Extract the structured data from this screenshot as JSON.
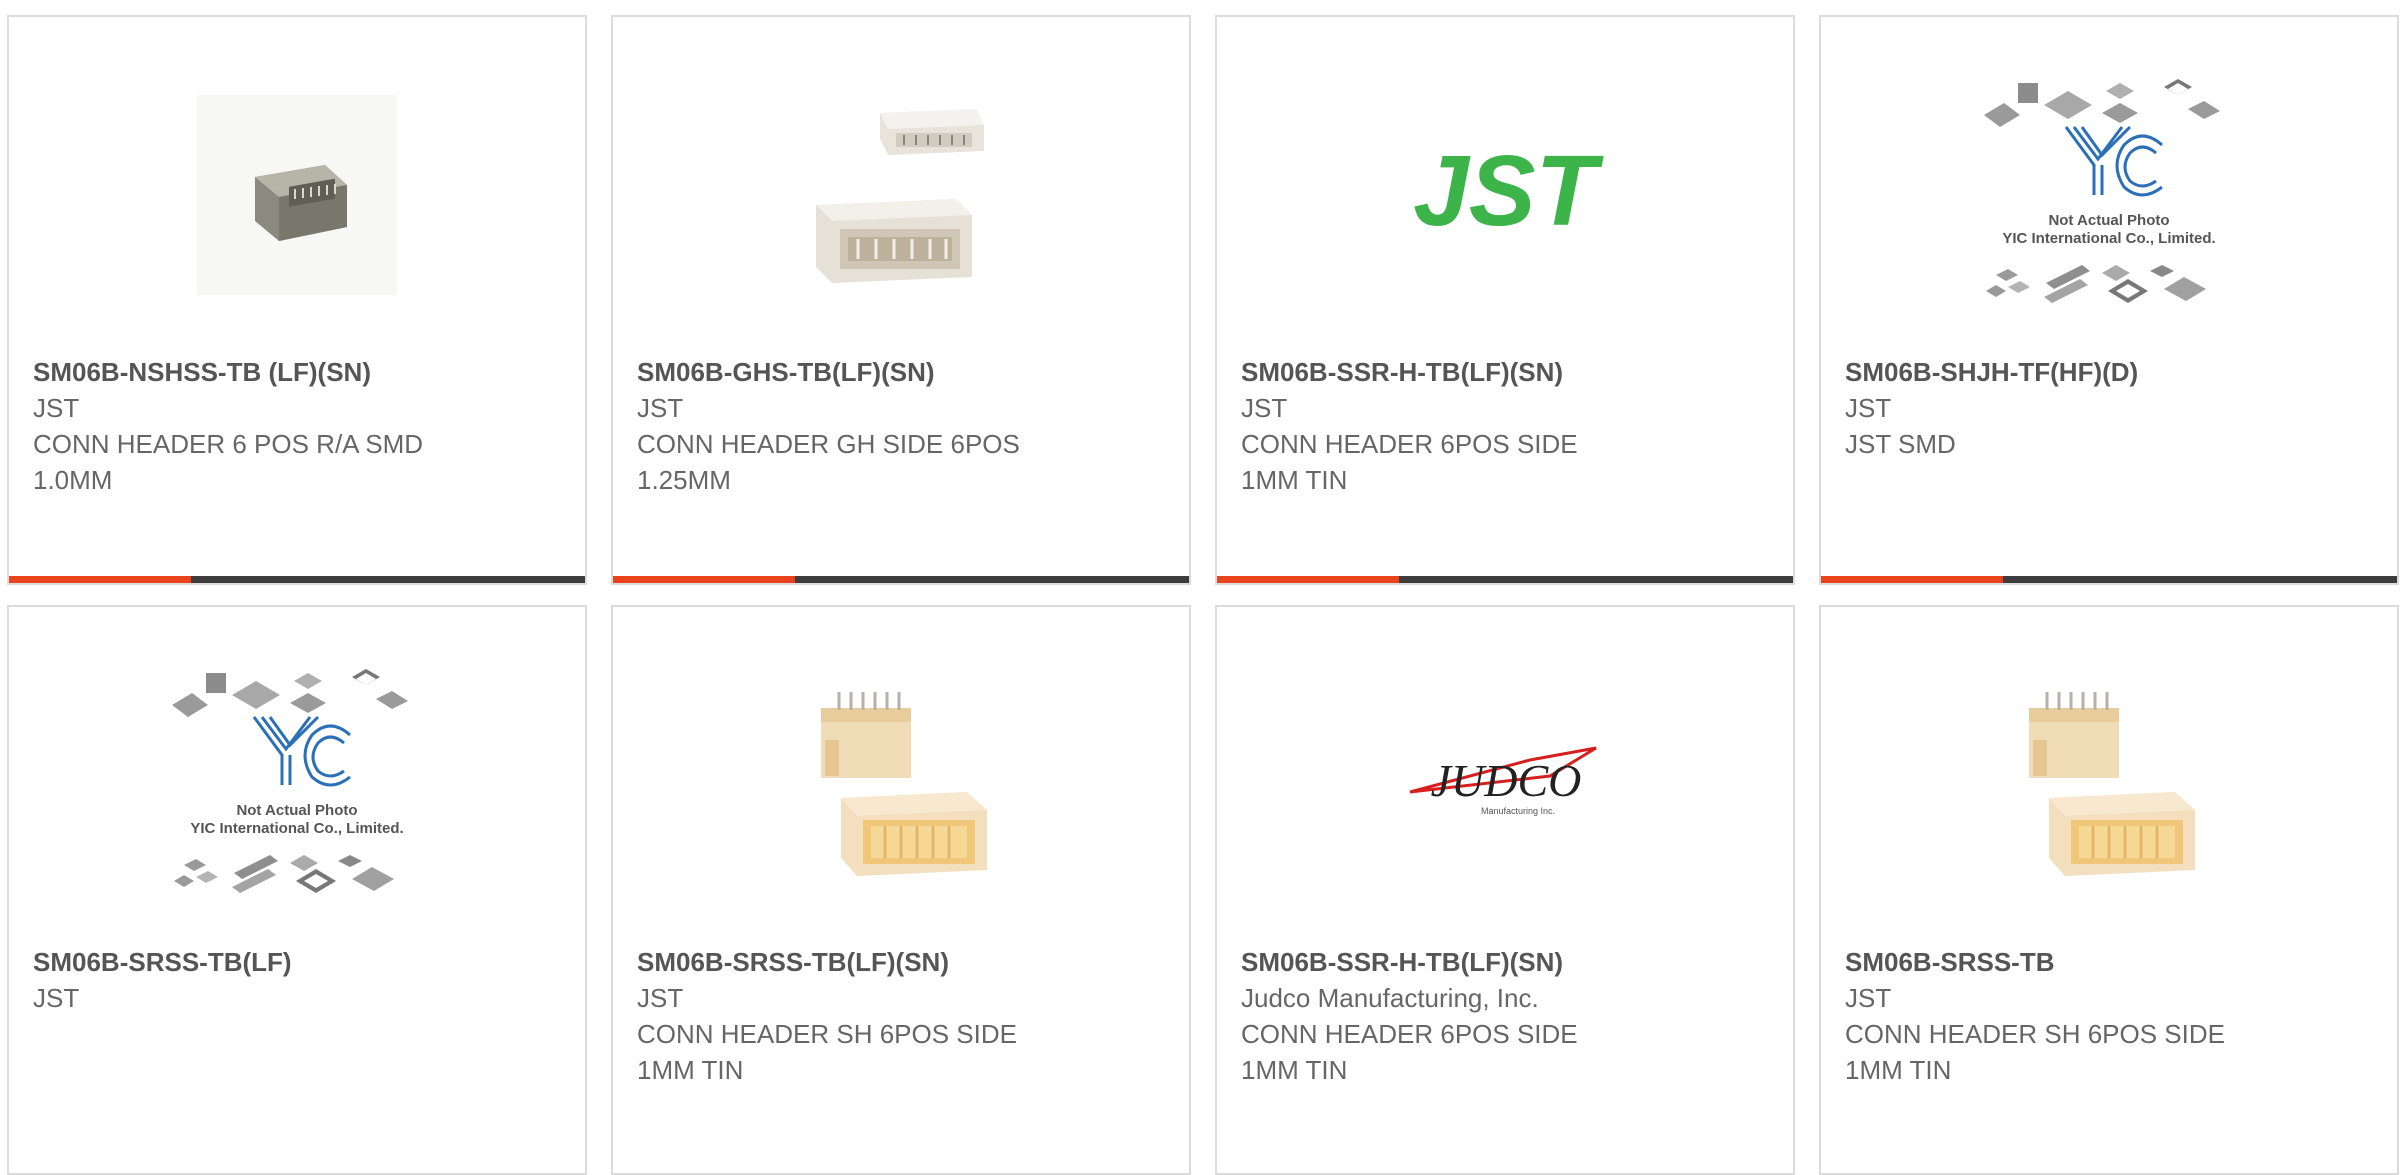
{
  "colors": {
    "accent": "#e8431c",
    "bar": "#3d3d3d",
    "jst_green": "#3cb44a",
    "yic_blue": "#2a6fb7"
  },
  "products": [
    {
      "part": "SM06B-NSHSS-TB (LF)(SN)",
      "maker": "JST",
      "desc1": "CONN HEADER 6 POS R/A SMD",
      "desc2": "1.0MM",
      "image": "gray-connector-photo"
    },
    {
      "part": "SM06B-GHS-TB(LF)(SN)",
      "maker": "JST",
      "desc1": "CONN HEADER GH SIDE 6POS",
      "desc2": "1.25MM",
      "image": "white-connector-photo"
    },
    {
      "part": "SM06B-SSR-H-TB(LF)(SN)",
      "maker": "JST",
      "desc1": "CONN HEADER 6POS SIDE",
      "desc2": "1MM TIN",
      "image": "jst-logo",
      "logo_text": "JST"
    },
    {
      "part": "SM06B-SHJH-TF(HF)(D)",
      "maker": "JST",
      "desc1": "JST SMD",
      "desc2": "",
      "image": "yic-not-actual-photo",
      "logo_text": "YIC",
      "caption1": "Not Actual Photo",
      "caption2": "YIC International Co., Limited."
    },
    {
      "part": "SM06B-SRSS-TB(LF)",
      "maker": "JST",
      "desc1": "",
      "desc2": "",
      "image": "yic-not-actual-photo",
      "logo_text": "YIC",
      "caption1": "Not Actual Photo",
      "caption2": "YIC International Co., Limited."
    },
    {
      "part": "SM06B-SRSS-TB(LF)(SN)",
      "maker": "JST",
      "desc1": "CONN HEADER SH 6POS SIDE",
      "desc2": "1MM TIN",
      "image": "beige-connector-photo"
    },
    {
      "part": "SM06B-SSR-H-TB(LF)(SN)",
      "maker": "Judco Manufacturing, Inc.",
      "desc1": "CONN HEADER 6POS SIDE",
      "desc2": "1MM TIN",
      "image": "judco-logo",
      "logo_text": "JUDCO",
      "logo_sub": "Manufacturing Inc."
    },
    {
      "part": "SM06B-SRSS-TB",
      "maker": "JST",
      "desc1": "CONN HEADER SH 6POS SIDE",
      "desc2": "1MM TIN",
      "image": "beige-connector-photo"
    }
  ]
}
